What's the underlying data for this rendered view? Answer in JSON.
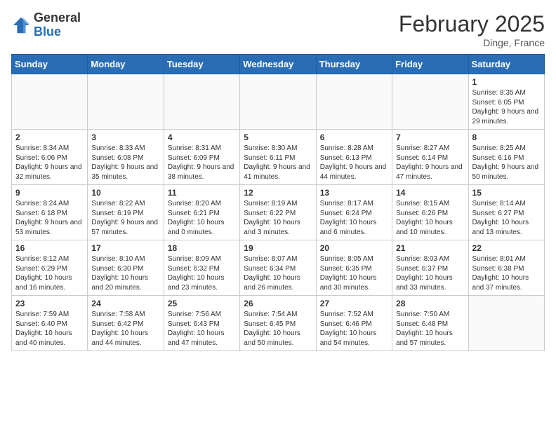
{
  "header": {
    "logo_general": "General",
    "logo_blue": "Blue",
    "month_title": "February 2025",
    "location": "Dinge, France"
  },
  "days_of_week": [
    "Sunday",
    "Monday",
    "Tuesday",
    "Wednesday",
    "Thursday",
    "Friday",
    "Saturday"
  ],
  "weeks": [
    {
      "days": [
        {
          "number": "",
          "info": ""
        },
        {
          "number": "",
          "info": ""
        },
        {
          "number": "",
          "info": ""
        },
        {
          "number": "",
          "info": ""
        },
        {
          "number": "",
          "info": ""
        },
        {
          "number": "",
          "info": ""
        },
        {
          "number": "1",
          "info": "Sunrise: 8:35 AM\nSunset: 6:05 PM\nDaylight: 9 hours and 29 minutes."
        }
      ]
    },
    {
      "days": [
        {
          "number": "2",
          "info": "Sunrise: 8:34 AM\nSunset: 6:06 PM\nDaylight: 9 hours and 32 minutes."
        },
        {
          "number": "3",
          "info": "Sunrise: 8:33 AM\nSunset: 6:08 PM\nDaylight: 9 hours and 35 minutes."
        },
        {
          "number": "4",
          "info": "Sunrise: 8:31 AM\nSunset: 6:09 PM\nDaylight: 9 hours and 38 minutes."
        },
        {
          "number": "5",
          "info": "Sunrise: 8:30 AM\nSunset: 6:11 PM\nDaylight: 9 hours and 41 minutes."
        },
        {
          "number": "6",
          "info": "Sunrise: 8:28 AM\nSunset: 6:13 PM\nDaylight: 9 hours and 44 minutes."
        },
        {
          "number": "7",
          "info": "Sunrise: 8:27 AM\nSunset: 6:14 PM\nDaylight: 9 hours and 47 minutes."
        },
        {
          "number": "8",
          "info": "Sunrise: 8:25 AM\nSunset: 6:16 PM\nDaylight: 9 hours and 50 minutes."
        }
      ]
    },
    {
      "days": [
        {
          "number": "9",
          "info": "Sunrise: 8:24 AM\nSunset: 6:18 PM\nDaylight: 9 hours and 53 minutes."
        },
        {
          "number": "10",
          "info": "Sunrise: 8:22 AM\nSunset: 6:19 PM\nDaylight: 9 hours and 57 minutes."
        },
        {
          "number": "11",
          "info": "Sunrise: 8:20 AM\nSunset: 6:21 PM\nDaylight: 10 hours and 0 minutes."
        },
        {
          "number": "12",
          "info": "Sunrise: 8:19 AM\nSunset: 6:22 PM\nDaylight: 10 hours and 3 minutes."
        },
        {
          "number": "13",
          "info": "Sunrise: 8:17 AM\nSunset: 6:24 PM\nDaylight: 10 hours and 6 minutes."
        },
        {
          "number": "14",
          "info": "Sunrise: 8:15 AM\nSunset: 6:26 PM\nDaylight: 10 hours and 10 minutes."
        },
        {
          "number": "15",
          "info": "Sunrise: 8:14 AM\nSunset: 6:27 PM\nDaylight: 10 hours and 13 minutes."
        }
      ]
    },
    {
      "days": [
        {
          "number": "16",
          "info": "Sunrise: 8:12 AM\nSunset: 6:29 PM\nDaylight: 10 hours and 16 minutes."
        },
        {
          "number": "17",
          "info": "Sunrise: 8:10 AM\nSunset: 6:30 PM\nDaylight: 10 hours and 20 minutes."
        },
        {
          "number": "18",
          "info": "Sunrise: 8:09 AM\nSunset: 6:32 PM\nDaylight: 10 hours and 23 minutes."
        },
        {
          "number": "19",
          "info": "Sunrise: 8:07 AM\nSunset: 6:34 PM\nDaylight: 10 hours and 26 minutes."
        },
        {
          "number": "20",
          "info": "Sunrise: 8:05 AM\nSunset: 6:35 PM\nDaylight: 10 hours and 30 minutes."
        },
        {
          "number": "21",
          "info": "Sunrise: 8:03 AM\nSunset: 6:37 PM\nDaylight: 10 hours and 33 minutes."
        },
        {
          "number": "22",
          "info": "Sunrise: 8:01 AM\nSunset: 6:38 PM\nDaylight: 10 hours and 37 minutes."
        }
      ]
    },
    {
      "days": [
        {
          "number": "23",
          "info": "Sunrise: 7:59 AM\nSunset: 6:40 PM\nDaylight: 10 hours and 40 minutes."
        },
        {
          "number": "24",
          "info": "Sunrise: 7:58 AM\nSunset: 6:42 PM\nDaylight: 10 hours and 44 minutes."
        },
        {
          "number": "25",
          "info": "Sunrise: 7:56 AM\nSunset: 6:43 PM\nDaylight: 10 hours and 47 minutes."
        },
        {
          "number": "26",
          "info": "Sunrise: 7:54 AM\nSunset: 6:45 PM\nDaylight: 10 hours and 50 minutes."
        },
        {
          "number": "27",
          "info": "Sunrise: 7:52 AM\nSunset: 6:46 PM\nDaylight: 10 hours and 54 minutes."
        },
        {
          "number": "28",
          "info": "Sunrise: 7:50 AM\nSunset: 6:48 PM\nDaylight: 10 hours and 57 minutes."
        },
        {
          "number": "",
          "info": ""
        }
      ]
    }
  ]
}
